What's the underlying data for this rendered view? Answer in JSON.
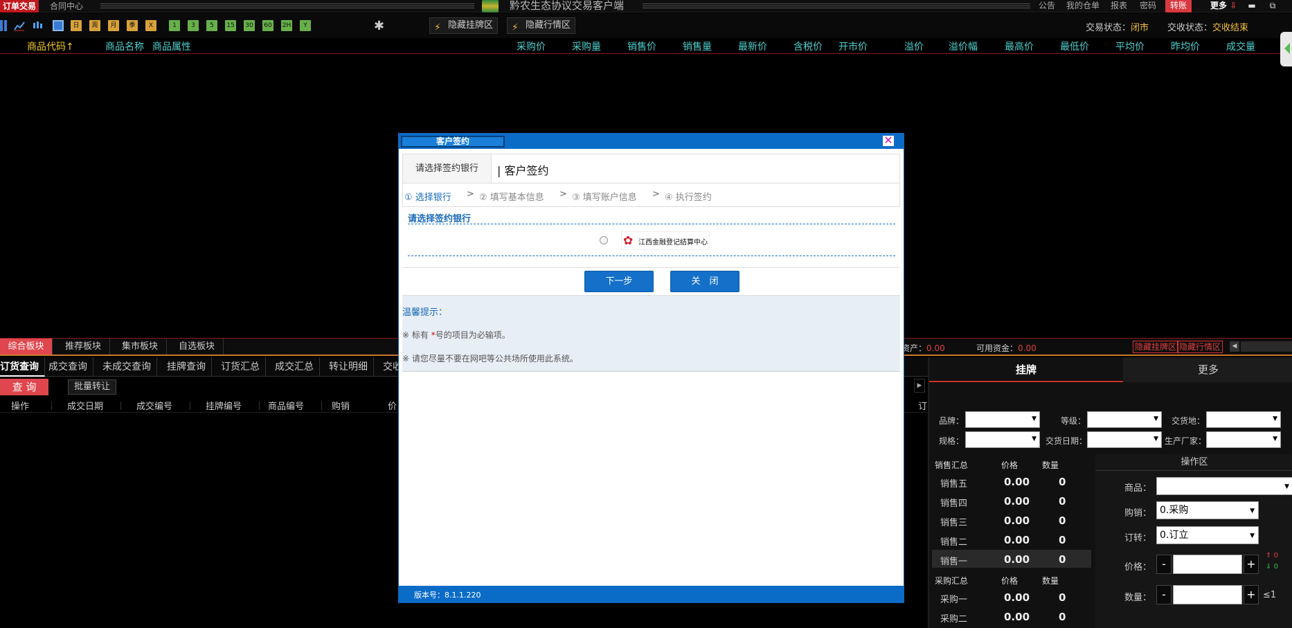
{
  "titlebar": {
    "tab_active": "订单交易",
    "tab_contract": "合同中心",
    "title": "黔农生态协议交易客户端",
    "links": [
      "公告",
      "我的仓单",
      "报表",
      "密码"
    ],
    "transfer": "转账",
    "more": "更多",
    "minimize": "▬",
    "restore": "⧉"
  },
  "toolbar": {
    "periods": [
      "日",
      "周",
      "月",
      "季",
      "X"
    ],
    "minutes": [
      "1",
      "3",
      "5",
      "15",
      "30",
      "60",
      "2H",
      "Y"
    ],
    "hide_listing": "隐藏挂牌区",
    "hide_quotes": "隐藏行情区",
    "trade_state_label": "交易状态：",
    "trade_state_value": "闭市",
    "settle_state_label": "交收状态：",
    "settle_state_value": "交收结束"
  },
  "columns": {
    "code": "商品代码↑",
    "name": "商品名称",
    "attr": "商品属性",
    "right": [
      "采购价",
      "采购量",
      "销售价",
      "销售量",
      "最新价",
      "含税价",
      "开市价",
      "溢价",
      "溢价幅",
      "最高价",
      "最低价",
      "平均价",
      "昨均价",
      "成交量"
    ]
  },
  "boards": {
    "tabs": [
      "综合板块",
      "推荐板块",
      "集市板块",
      "自选板块"
    ],
    "active_index": 0,
    "asset_label": "资产：",
    "asset_value": "0.00",
    "funds_label": "可用资金：",
    "funds_value": "0.00",
    "hide_listing": "隐藏挂牌区",
    "hide_quotes": "隐藏行情区"
  },
  "query": {
    "tabs": [
      "订货查询",
      "成交查询",
      "未成交查询",
      "挂牌查询",
      "订货汇总",
      "成交汇总",
      "转让明细",
      "交收"
    ],
    "query_btn": "查 询",
    "batch_btn": "批量转让",
    "headers": [
      "操作",
      "成交日期",
      "成交编号",
      "挂牌编号",
      "商品编号",
      "购销",
      "价",
      "订"
    ]
  },
  "right_panel": {
    "tab_listing": "挂牌",
    "tab_more": "更多",
    "filters": {
      "brand": "品牌：",
      "grade": "等级：",
      "delivery_place": "交货地：",
      "spec": "规格：",
      "delivery_date": "交货日期：",
      "maker": "生产厂家："
    },
    "sell_summary": "销售汇总",
    "buy_summary": "采购汇总",
    "price_h": "价格",
    "qty_h": "数量",
    "sell_rows": [
      {
        "name": "销售五",
        "price": "0.00",
        "qty": "0"
      },
      {
        "name": "销售四",
        "price": "0.00",
        "qty": "0"
      },
      {
        "name": "销售三",
        "price": "0.00",
        "qty": "0"
      },
      {
        "name": "销售二",
        "price": "0.00",
        "qty": "0"
      },
      {
        "name": "销售一",
        "price": "0.00",
        "qty": "0"
      }
    ],
    "buy_rows": [
      {
        "name": "采购一",
        "price": "0.00",
        "qty": "0"
      },
      {
        "name": "采购二",
        "price": "0.00",
        "qty": "0"
      }
    ],
    "op_area": {
      "title": "操作区",
      "product_label": "商品：",
      "side_label": "购销：",
      "side_value": "0.采购",
      "order_label": "订转：",
      "order_value": "0.订立",
      "price_label": "价格：",
      "qty_label": "数量：",
      "minus": "-",
      "plus": "+",
      "qty_limit": "≤1",
      "up_count": "0",
      "down_count": "0"
    }
  },
  "modal": {
    "title": "客户签约",
    "close": "✕",
    "subhead_tab": "请选择签约银行",
    "subhead_title": "| 客户签约",
    "steps": [
      "① 选择银行",
      "② 填写基本信息",
      "③ 填写账户信息",
      "④ 执行签约"
    ],
    "step_arrow": ">",
    "bank_section_title": "请选择签约银行",
    "bank_name": "江西金融登记结算中心",
    "next": "下一步",
    "close_btn": "关　闭",
    "tips_title": "温馨提示：",
    "tip1_pre": "※ 标有 ",
    "tip1_star": "*",
    "tip1_post": "号的项目为必输项。",
    "tip2": "※ 请您尽量不要在网吧等公共场所使用此系统。",
    "version": "版本号：8.1.1.220"
  },
  "colors": {
    "accent_red": "#e0464d",
    "modal_blue": "#0b6cc8",
    "header_cyan": "#4fd0cf",
    "state_yellow": "#f0c040"
  }
}
